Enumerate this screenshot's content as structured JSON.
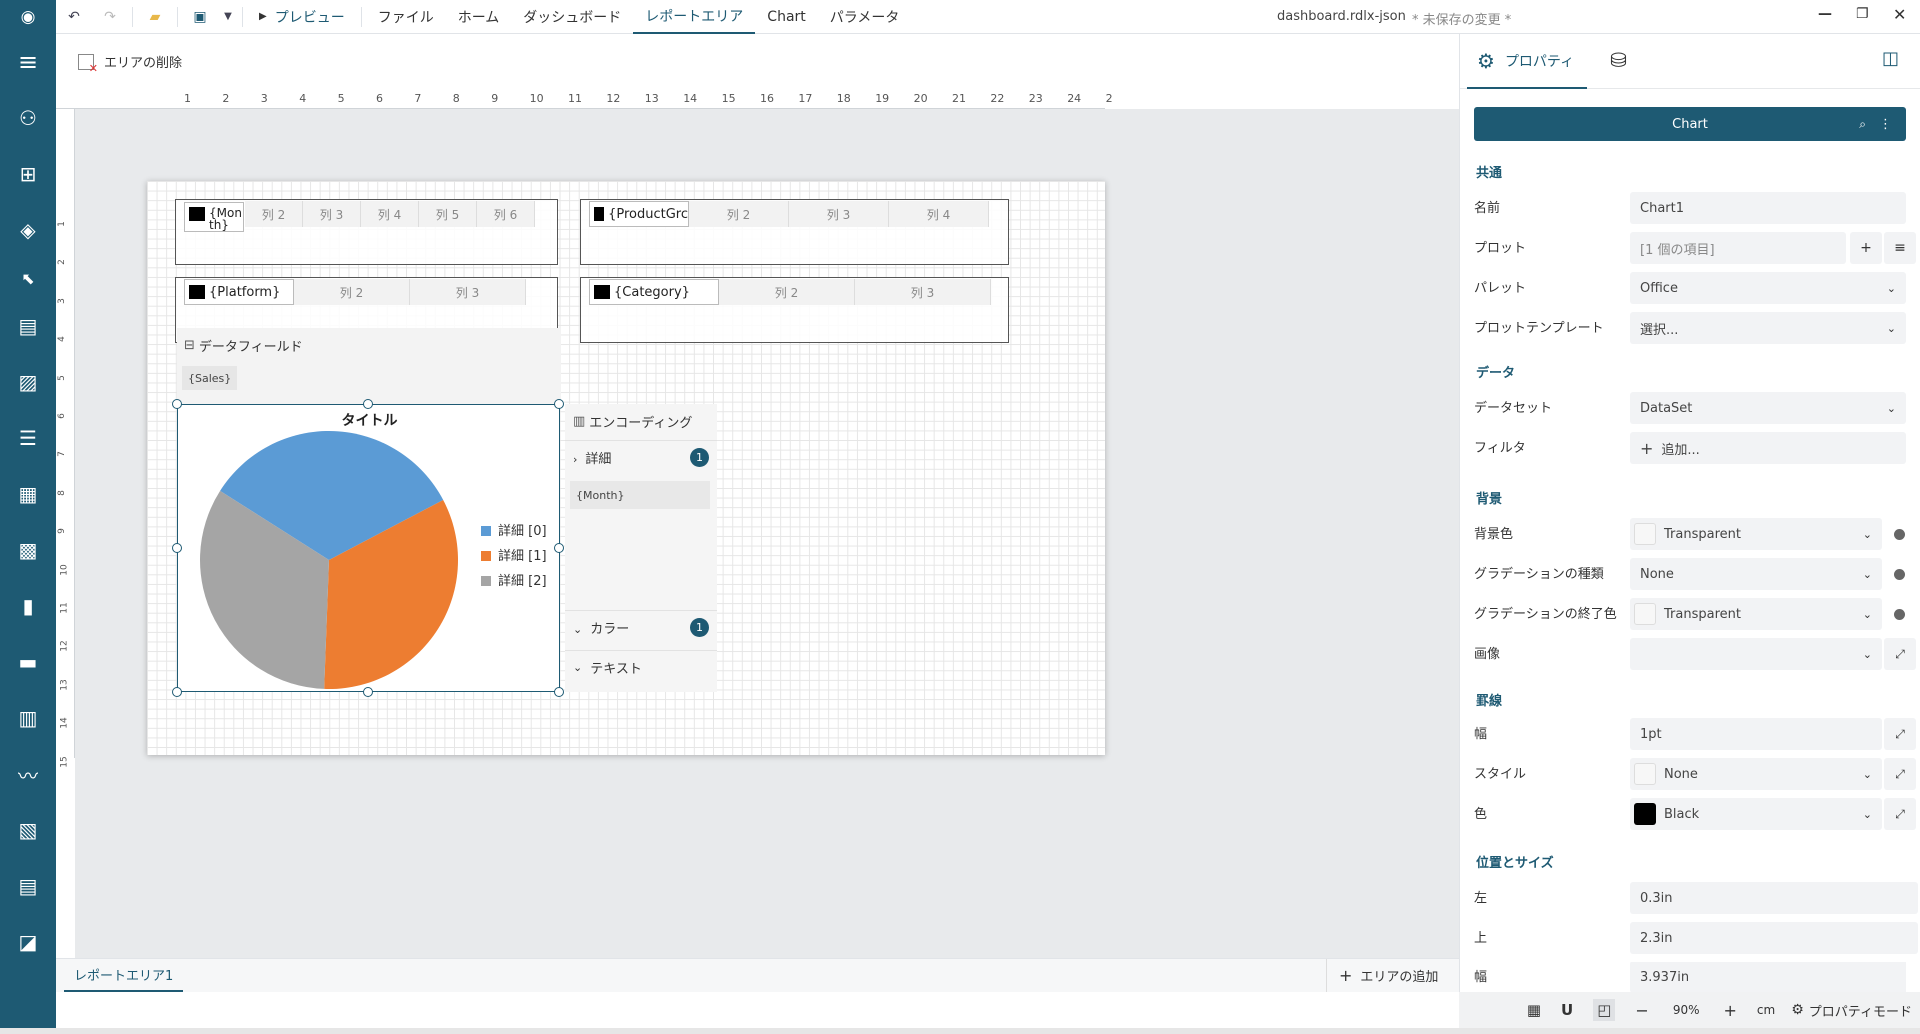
{
  "topbar": {
    "menu": [
      "プレビュー",
      "ファイル",
      "ホーム",
      "ダッシュボード",
      "レポートエリア",
      "Chart",
      "パラメータ"
    ],
    "filename": "dashboard.rdlx-json",
    "unsaved": "* 未保存の変更 *"
  },
  "toolbar2": {
    "delete_area": "エリアの削除"
  },
  "ruler": {
    "h": [
      "1",
      "2",
      "3",
      "4",
      "5",
      "6",
      "7",
      "8",
      "9",
      "10",
      "11",
      "12",
      "13",
      "14",
      "15",
      "16",
      "17",
      "18",
      "19",
      "20",
      "21",
      "22",
      "23",
      "24",
      "2"
    ],
    "v": [
      "1",
      "2",
      "3",
      "4",
      "5",
      "6",
      "7",
      "8",
      "9",
      "10",
      "11",
      "12",
      "13",
      "14",
      "15"
    ]
  },
  "tables": {
    "t1": {
      "first": "{Mon th}",
      "cols": [
        "列 2",
        "列 3",
        "列 4",
        "列 5",
        "列 6"
      ]
    },
    "t2": {
      "first": "{ProductGrc",
      "cols": [
        "列 2",
        "列 3",
        "列 4"
      ]
    },
    "t3": {
      "first": "{Platform}",
      "cols": [
        "列 2",
        "列 3"
      ]
    },
    "t4": {
      "first": "{Category}",
      "cols": [
        "列 2",
        "列 3"
      ]
    }
  },
  "datafield": {
    "title": "データフィールド",
    "chip": "{Sales}"
  },
  "chart": {
    "title": "タイトル"
  },
  "chart_data": {
    "type": "pie",
    "categories": [
      "詳細 [0]",
      "詳細 [1]",
      "詳細 [2]"
    ],
    "values": [
      33.3,
      33.3,
      33.4
    ],
    "colors": [
      "#5b9bd5",
      "#ed7d31",
      "#a5a5a5"
    ],
    "title": "タイトル",
    "legend": "right"
  },
  "encoding": {
    "title": "エンコーディング",
    "details": "詳細",
    "details_count": "1",
    "details_chip": "{Month}",
    "color": "カラー",
    "color_count": "1",
    "text": "テキスト"
  },
  "bottom": {
    "tab": "レポートエリア1",
    "add": "エリアの追加"
  },
  "status": {
    "zoom": "90%",
    "unit": "cm",
    "mode": "プロパティモード"
  },
  "panel": {
    "tab_props": "プロパティ",
    "header": "Chart",
    "sec_common": "共通",
    "name_label": "名前",
    "name_val": "Chart1",
    "plot_label": "プロット",
    "plot_val": "[1 個の項目]",
    "palette_label": "パレット",
    "palette_val": "Office",
    "plottemplate_label": "プロットテンプレート",
    "plottemplate_val": "選択...",
    "sec_data": "データ",
    "dataset_label": "データセット",
    "dataset_val": "DataSet",
    "filter_label": "フィルタ",
    "filter_val": "追加...",
    "sec_bg": "背景",
    "bgcolor_label": "背景色",
    "bgcolor_val": "Transparent",
    "gradtype_label": "グラデーションの種類",
    "gradtype_val": "None",
    "gradend_label": "グラデーションの終了色",
    "gradend_val": "Transparent",
    "image_label": "画像",
    "image_val": "",
    "sec_border": "罫線",
    "bwidth_label": "幅",
    "bwidth_val": "1pt",
    "bstyle_label": "スタイル",
    "bstyle_val": "None",
    "bcolor_label": "色",
    "bcolor_val": "Black",
    "sec_pos": "位置とサイズ",
    "left_label": "左",
    "left_val": "0.3in",
    "top_label": "上",
    "top_val": "2.3in",
    "width_label": "幅",
    "width_val": "3.937in"
  }
}
